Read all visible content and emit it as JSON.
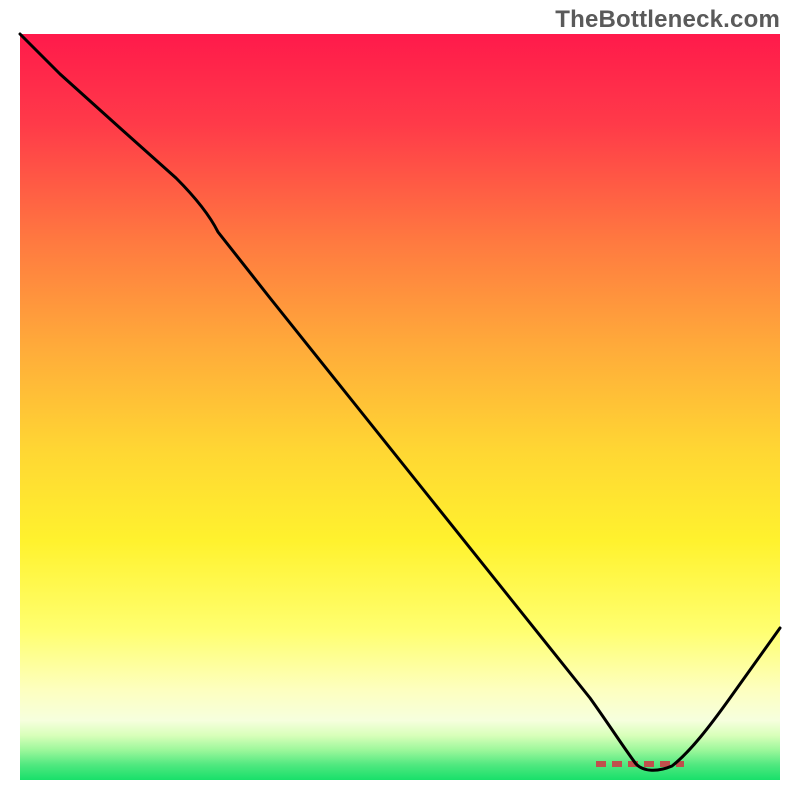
{
  "watermark": "TheBottleneck.com",
  "colors": {
    "top": "#ff1a4b",
    "mid_upper": "#ff8c3a",
    "mid": "#ffe531",
    "mid_lower": "#ffff8a",
    "cream": "#fcffd6",
    "green": "#18e06a",
    "curve": "#000000",
    "dash": "#c0504d"
  },
  "chart_data": {
    "type": "line",
    "title": "",
    "xlabel": "",
    "ylabel": "",
    "xlim": [
      0,
      100
    ],
    "ylim": [
      0,
      100
    ],
    "series": [
      {
        "name": "bottleneck-curve",
        "x": [
          0,
          5,
          12,
          20,
          24,
          30,
          40,
          50,
          60,
          70,
          78,
          80,
          82,
          85,
          90,
          95,
          100
        ],
        "y": [
          100,
          94,
          87,
          79,
          74,
          65,
          53,
          41,
          29,
          17,
          5,
          2,
          1,
          1,
          7,
          14,
          22
        ]
      }
    ],
    "optimal_region": {
      "x_start": 78,
      "x_end": 88,
      "y": 1
    },
    "gradient_stops": [
      {
        "pct": 0,
        "color": "#ff1a4b"
      },
      {
        "pct": 42,
        "color": "#ff9a3a"
      },
      {
        "pct": 63,
        "color": "#ffe531"
      },
      {
        "pct": 82,
        "color": "#ffff8a"
      },
      {
        "pct": 92,
        "color": "#fcffd6"
      },
      {
        "pct": 96,
        "color": "#b8ff9f"
      },
      {
        "pct": 100,
        "color": "#18e06a"
      }
    ]
  }
}
